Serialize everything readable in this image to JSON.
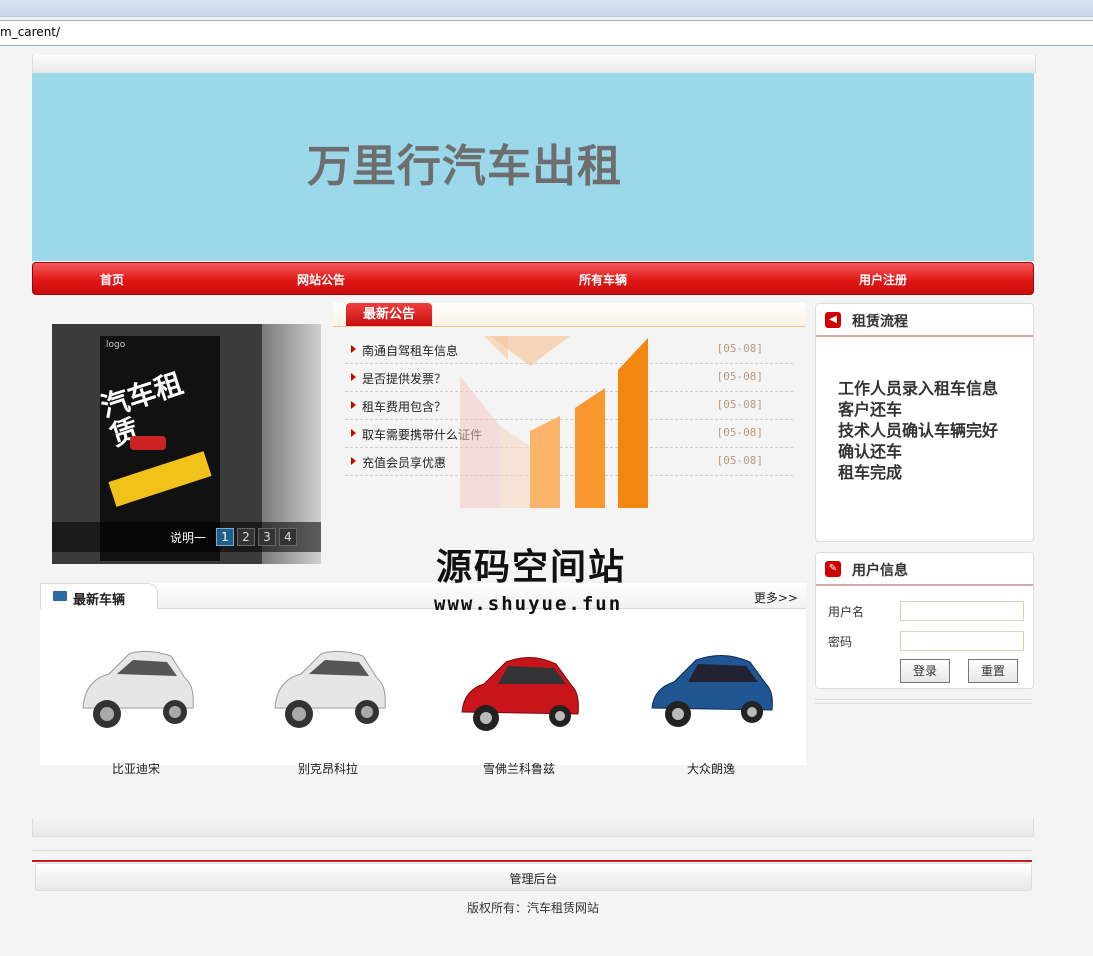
{
  "browser": {
    "address": "m_carent/"
  },
  "banner": {
    "title": "万里行汽车出租"
  },
  "nav": {
    "items": [
      "首页",
      "网站公告",
      "所有车辆",
      "用户注册"
    ]
  },
  "slideshow": {
    "caption": "说明一",
    "pages": [
      "1",
      "2",
      "3",
      "4"
    ],
    "active_page": 1,
    "poster_logo": "logo",
    "poster_title": "汽车租赁"
  },
  "news": {
    "tab_label": "最新公告",
    "items": [
      {
        "title": "南通自驾租车信息",
        "date": "[05-08]"
      },
      {
        "title": "是否提供发票？",
        "date": "[05-08]"
      },
      {
        "title": "租车费用包含？",
        "date": "[05-08]"
      },
      {
        "title": "取车需要携带什么证件",
        "date": "[05-08]"
      },
      {
        "title": "充值会员享优惠",
        "date": "[05-08]"
      }
    ]
  },
  "watermark": {
    "text": "源码空间站",
    "url": "www.shuyue.fun"
  },
  "cars": {
    "title": "最新车辆",
    "more": "更多>>",
    "items": [
      {
        "name": "比亚迪宋",
        "color": "#e9e9e9"
      },
      {
        "name": "别克昂科拉",
        "color": "#e9e9e9"
      },
      {
        "name": "雪佛兰科鲁兹",
        "color": "#c9141c"
      },
      {
        "name": "大众朗逸",
        "color": "#1f5590"
      }
    ]
  },
  "flow": {
    "title": "租赁流程",
    "steps": [
      "工作人员录入租车信息",
      "客户还车",
      "技术人员确认车辆完好",
      "确认还车",
      "租车完成"
    ]
  },
  "user": {
    "title": "用户信息",
    "username_label": "用户名",
    "password_label": "密码",
    "username_value": "",
    "password_value": "",
    "login_label": "登录",
    "reset_label": "重置"
  },
  "footer": {
    "admin_link": "管理后台",
    "copyright": "版权所有：汽车租赁网站"
  }
}
